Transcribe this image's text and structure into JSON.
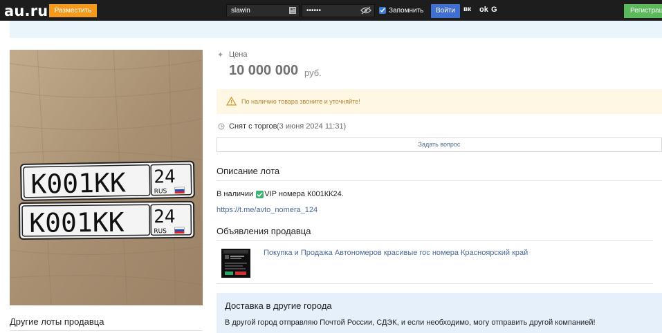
{
  "header": {
    "logo": "au.ru",
    "post_button": "Разместить",
    "username_value": "slawin",
    "password_value": "••••••",
    "remember_label": "Запомнить",
    "remember_checked": true,
    "login_button": "Войти",
    "social": [
      "вк",
      "ok",
      "G"
    ],
    "register_button": "Регистрация",
    "colors": {
      "post": "#f39a1c",
      "login": "#3f6fd1",
      "register": "#5bb85b",
      "bar": "#1d1d1d"
    }
  },
  "lot": {
    "price_label": "Цена",
    "price_value": "10 000 000",
    "price_currency": "руб.",
    "warning_text": "По наличию товара звоните и уточняйте!",
    "status_text": "Снят с торгов",
    "status_date": "(3 июня 2024 11:31)",
    "ask_button": "Задать вопрос",
    "plate": {
      "main": "К001КК",
      "region": "24",
      "country": "RUS"
    }
  },
  "description": {
    "title": "Описание лота",
    "text_before": "В наличии",
    "text_after": "VIP номера К001КК24.",
    "link": "https://t.me/avto_nomera_124"
  },
  "seller": {
    "title": "Объявления продавца",
    "listing_link": "Покупка и Продажа Автономеров красивые гос номера Красноярский край"
  },
  "delivery": {
    "title": "Доставка в другие города",
    "text": "В другой город отправляю Почтой России, СДЭК, и если необходимо, могу отправить другой компанией!"
  },
  "sidebar": {
    "other_lots_title": "Другие лоты продавца"
  }
}
